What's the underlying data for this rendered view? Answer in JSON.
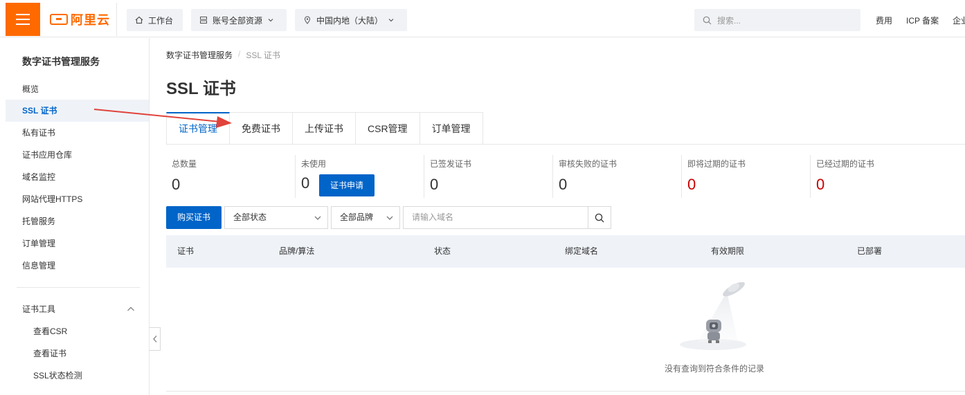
{
  "header": {
    "logo_text": "阿里云",
    "workbench_label": "工作台",
    "resources_label": "账号全部资源",
    "region_label": "中国内地（大陆）",
    "search_placeholder": "搜索...",
    "links": [
      "费用",
      "ICP 备案",
      "企业"
    ],
    "brand_color": "#ff6a00"
  },
  "sidebar": {
    "title": "数字证书管理服务",
    "items": [
      {
        "label": "概览",
        "active": false
      },
      {
        "label": "SSL 证书",
        "active": true
      },
      {
        "label": "私有证书",
        "active": false
      },
      {
        "label": "证书应用仓库",
        "active": false
      },
      {
        "label": "域名监控",
        "active": false
      },
      {
        "label": "网站代理HTTPS",
        "active": false
      },
      {
        "label": "托管服务",
        "active": false
      },
      {
        "label": "订单管理",
        "active": false
      },
      {
        "label": "信息管理",
        "active": false
      }
    ],
    "tools_group": {
      "label": "证书工具",
      "items": [
        "查看CSR",
        "查看证书",
        "SSL状态检测"
      ]
    }
  },
  "main": {
    "breadcrumb": [
      "数字证书管理服务",
      "SSL 证书"
    ],
    "title": "SSL 证书",
    "tabs": [
      {
        "label": "证书管理",
        "active": true
      },
      {
        "label": "免费证书",
        "active": false
      },
      {
        "label": "上传证书",
        "active": false
      },
      {
        "label": "CSR管理",
        "active": false
      },
      {
        "label": "订单管理",
        "active": false
      }
    ],
    "stats": [
      {
        "label": "总数量",
        "value": "0",
        "alert": false
      },
      {
        "label": "未使用",
        "value": "0",
        "alert": false
      },
      {
        "label": "已签发证书",
        "value": "0",
        "alert": false
      },
      {
        "label": "审核失败的证书",
        "value": "0",
        "alert": false
      },
      {
        "label": "即将过期的证书",
        "value": "0",
        "alert": true
      },
      {
        "label": "已经过期的证书",
        "value": "0",
        "alert": true
      }
    ],
    "apply_button": "证书申请",
    "buy_button": "购买证书",
    "status_select": "全部状态",
    "brand_select": "全部品牌",
    "domain_placeholder": "请输入域名",
    "table_headers": [
      "证书",
      "品牌/算法",
      "状态",
      "绑定域名",
      "有效期限",
      "已部署"
    ],
    "empty_text": "没有查询到符合条件的记录",
    "accent_color": "#0064c8",
    "alert_color": "#c80000"
  }
}
